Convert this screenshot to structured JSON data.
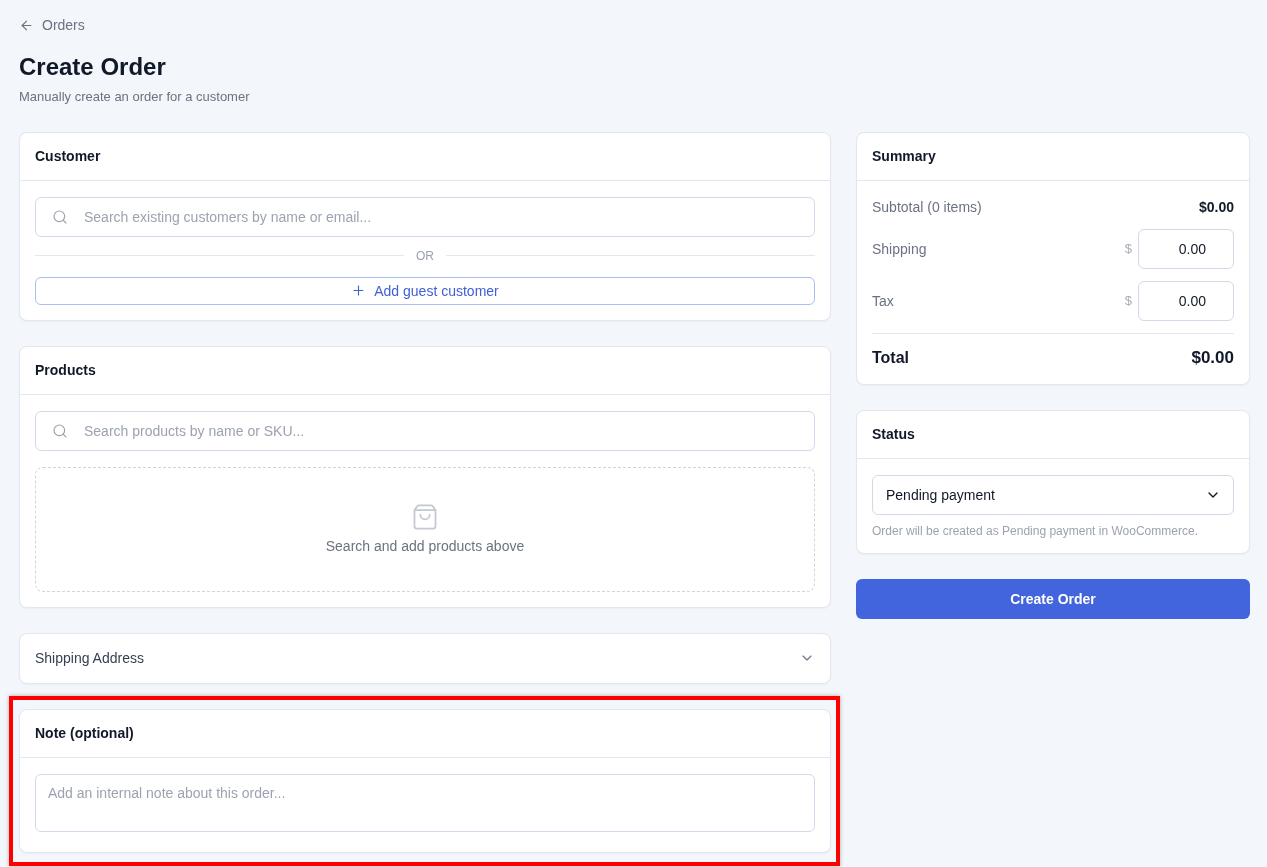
{
  "back_link": {
    "label": "Orders"
  },
  "header": {
    "title": "Create Order",
    "subtitle": "Manually create an order for a customer"
  },
  "customer": {
    "title": "Customer",
    "search": {
      "placeholder": "Search existing customers by name or email..."
    },
    "divider": "OR",
    "add_button": "Add guest customer"
  },
  "products": {
    "title": "Products",
    "search": {
      "placeholder": "Search products by name or SKU..."
    },
    "empty_text": "Search and add products above"
  },
  "shipping_address": {
    "title": "Shipping Address",
    "expanded": false
  },
  "note": {
    "title": "Note (optional)",
    "placeholder": "Add an internal note about this order...",
    "highlighted": true
  },
  "summary": {
    "title": "Summary",
    "rows": [
      {
        "kind": "text",
        "label": "Subtotal (0 items)",
        "value": "$0.00"
      },
      {
        "kind": "input",
        "label": "Shipping",
        "currency": "$",
        "value": "0.00"
      },
      {
        "kind": "input",
        "label": "Tax",
        "currency": "$",
        "value": "0.00"
      }
    ],
    "total": {
      "label": "Total",
      "value": "$0.00"
    }
  },
  "status": {
    "title": "Status",
    "select": {
      "value": "Pending payment"
    },
    "helper": "Order will be created as Pending payment in WooCommerce."
  },
  "submit_button": "Create Order"
}
